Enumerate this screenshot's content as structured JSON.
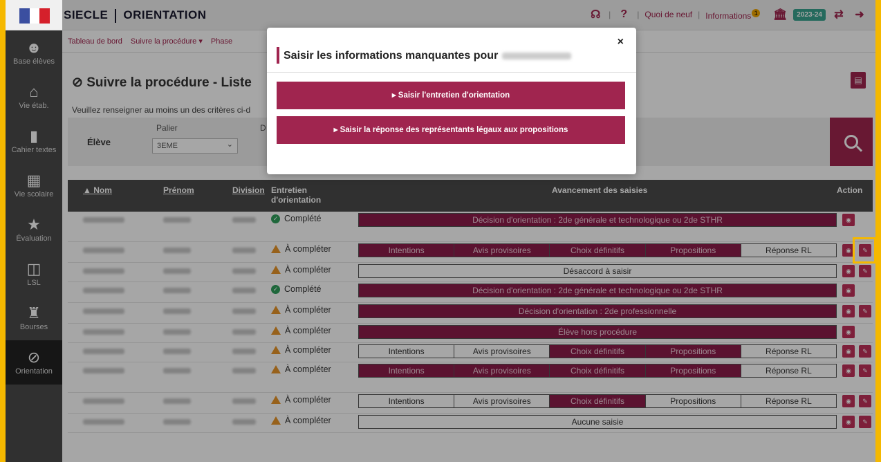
{
  "header": {
    "app_name": "SIECLE",
    "module": "ORIENTATION",
    "quoi_de_neuf": "Quoi de neuf",
    "informations": "Informations",
    "notif_count": "1",
    "year": "2023-24"
  },
  "sidebar": {
    "items": [
      {
        "label": "Base élèves",
        "icon": "students-icon"
      },
      {
        "label": "Vie étab.",
        "icon": "building-icon"
      },
      {
        "label": "Cahier textes",
        "icon": "book-icon"
      },
      {
        "label": "Vie scolaire",
        "icon": "calendar-icon"
      },
      {
        "label": "Évaluation",
        "icon": "star-icon"
      },
      {
        "label": "LSL",
        "icon": "open-book-icon"
      },
      {
        "label": "Bourses",
        "icon": "bag-icon"
      },
      {
        "label": "Orientation",
        "icon": "compass-icon"
      }
    ]
  },
  "submenu": {
    "dashboard": "Tableau de bord",
    "follow": "Suivre la procédure ▾",
    "phase": "Phase"
  },
  "page": {
    "title": "Suivre la procédure - Liste",
    "hint": "Veuillez renseigner au moins un des critères ci-d"
  },
  "filter": {
    "eleve_label": "Élève",
    "palier_label": "Palier",
    "palier_value": "3EME",
    "d_label": "D"
  },
  "table": {
    "headers": {
      "nom": "▲ Nom",
      "prenom": "Prénom",
      "division": "Division",
      "entretien": "Entretien d'orientation",
      "avancement": "Avancement des saisies",
      "action": "Action"
    },
    "segments": [
      "Intentions",
      "Avis provisoires",
      "Choix définitifs",
      "Propositions",
      "Réponse RL"
    ],
    "rows": [
      {
        "status": "Complété",
        "ok": true,
        "full": "Décision d'orientation : 2de générale et technologique ou 2de STHR",
        "full_done": true,
        "edit": false
      },
      {
        "status": "À compléter",
        "ok": false,
        "segs": [
          1,
          1,
          1,
          1,
          0
        ],
        "edit": true
      },
      {
        "status": "À compléter",
        "ok": false,
        "full": "Désaccord à saisir",
        "full_done": false,
        "edit": true
      },
      {
        "status": "Complété",
        "ok": true,
        "full": "Décision d'orientation : 2de générale et technologique ou 2de STHR",
        "full_done": true,
        "edit": false
      },
      {
        "status": "À compléter",
        "ok": false,
        "full": "Décision d'orientation : 2de professionnelle",
        "full_done": true,
        "edit": true
      },
      {
        "status": "À compléter",
        "ok": false,
        "full": "Élève hors procédure",
        "full_done": true,
        "edit": false
      },
      {
        "status": "À compléter",
        "ok": false,
        "segs": [
          0,
          0,
          1,
          1,
          0
        ],
        "edit": true
      },
      {
        "status": "À compléter",
        "ok": false,
        "segs": [
          1,
          1,
          1,
          1,
          0
        ],
        "edit": true
      },
      {
        "status": "À compléter",
        "ok": false,
        "segs": [
          0,
          0,
          1,
          0,
          0
        ],
        "edit": true
      },
      {
        "status": "À compléter",
        "ok": false,
        "full": "Aucune saisie",
        "full_done": false,
        "edit": true
      }
    ]
  },
  "modal": {
    "title": "Saisir les informations manquantes pour",
    "close": "×",
    "btn1": "▸ Saisir l'entretien d'orientation",
    "btn2": "▸ Saisir la réponse des représentants légaux aux propositions"
  },
  "colors": {
    "accent": "#a0254f",
    "done": "#8d1d4b",
    "highlight": "#f5b800"
  }
}
